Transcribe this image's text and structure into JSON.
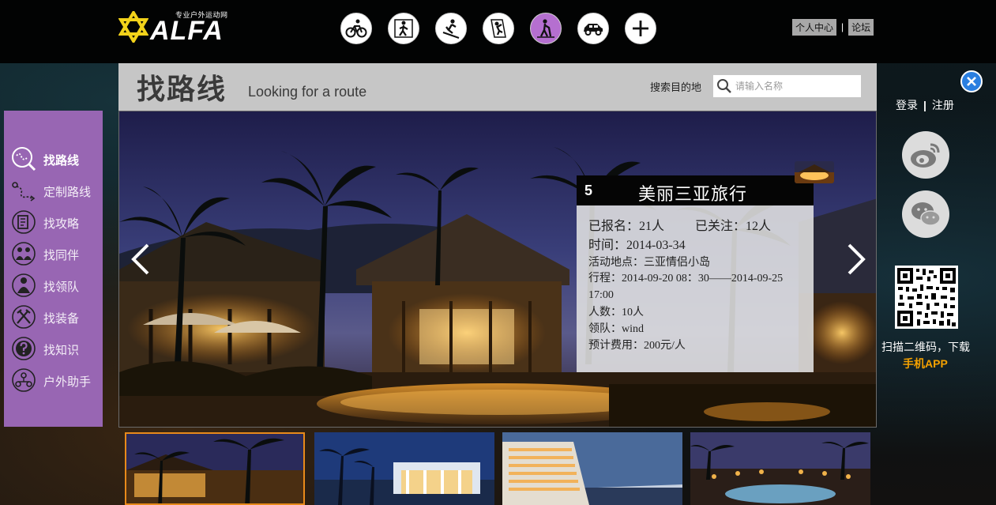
{
  "site": {
    "logo_tagline": "专业户外运动网",
    "logo_text": "ALFA"
  },
  "sports": [
    {
      "icon": "cycling-icon"
    },
    {
      "icon": "hiking-icon"
    },
    {
      "icon": "skiing-icon"
    },
    {
      "icon": "climbing-icon"
    },
    {
      "icon": "trekking-icon",
      "active": true
    },
    {
      "icon": "car-icon"
    },
    {
      "icon": "add-icon"
    }
  ],
  "top_links": {
    "personal_center": "个人中心",
    "separator": "|",
    "forum": "论坛"
  },
  "header": {
    "title_cn": "找路线",
    "title_en": "Looking for a route",
    "search_label": "搜索目的地",
    "search_placeholder": "请输入名称"
  },
  "left_nav": [
    {
      "label": "找路线",
      "icon": "route-search-icon",
      "active": true
    },
    {
      "label": "定制路线",
      "icon": "custom-route-icon"
    },
    {
      "label": "找攻略",
      "icon": "guide-book-icon"
    },
    {
      "label": "找同伴",
      "icon": "companions-icon"
    },
    {
      "label": "找领队",
      "icon": "leader-icon"
    },
    {
      "label": "找装备",
      "icon": "equipment-icon"
    },
    {
      "label": "找知识",
      "icon": "knowledge-icon"
    },
    {
      "label": "户外助手",
      "icon": "outdoor-assistant-icon"
    }
  ],
  "route": {
    "number": "5",
    "title": "美丽三亚旅行",
    "signed_up": "已报名：21人",
    "followers": "已关注：12人",
    "time": "时间：2014-03-34",
    "location": "活动地点：三亚情侣小岛",
    "itinerary": "行程：2014-09-20 08：30——2014-09-25 17:00",
    "people": "人数：10人",
    "leader": "领队：wind",
    "cost": "预计费用：200元/人"
  },
  "right_panel": {
    "login": "登录",
    "separator": "|",
    "register": "注册",
    "social": [
      {
        "icon": "weibo-icon"
      },
      {
        "icon": "wechat-icon"
      }
    ],
    "qr_caption": "扫描二维码，下载",
    "app_label": "手机APP"
  },
  "thumbnails": [
    {
      "scene": "resort-night",
      "active": true
    },
    {
      "scene": "beach-pavilion"
    },
    {
      "scene": "hotel-tower"
    },
    {
      "scene": "pool-dusk"
    }
  ],
  "colors": {
    "nav_purple": "#9866b3",
    "active_sport": "#b56fd0",
    "accent_orange": "#f4a100",
    "close_blue": "#2a7fe0"
  }
}
